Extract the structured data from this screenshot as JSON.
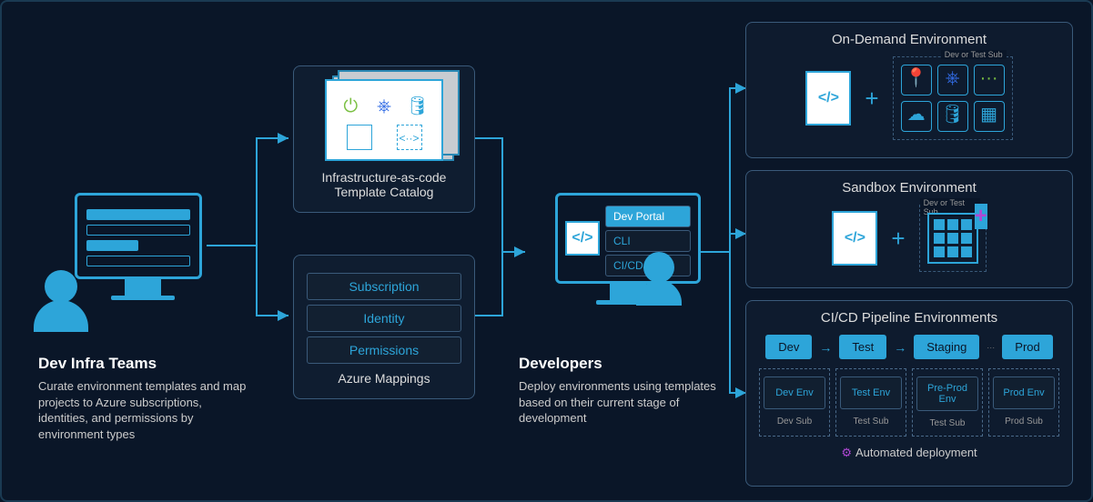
{
  "left": {
    "title": "Dev Infra Teams",
    "desc": "Curate environment templates and map projects to Azure subscriptions, identities, and permissions by environment types"
  },
  "template_catalog": {
    "label": "Infrastructure-as-code Template Catalog"
  },
  "azure_mappings": {
    "label": "Azure Mappings",
    "items": [
      "Subscription",
      "Identity",
      "Permissions"
    ]
  },
  "developers": {
    "title": "Developers",
    "desc": "Deploy environments using templates based on their current stage of development",
    "screen_items": [
      "Dev Portal",
      "CLI",
      "CI/CD"
    ]
  },
  "environments": {
    "ondemand": {
      "title": "On-Demand Environment",
      "sub_label": "Dev or Test Sub"
    },
    "sandbox": {
      "title": "Sandbox Environment",
      "sub_label": "Dev or Test Sub"
    },
    "cicd": {
      "title": "CI/CD Pipeline Environments",
      "stages": [
        "Dev",
        "Test",
        "Staging",
        "Prod"
      ],
      "envs": [
        {
          "name": "Dev Env",
          "sub": "Dev Sub"
        },
        {
          "name": "Test Env",
          "sub": "Test Sub"
        },
        {
          "name": "Pre-Prod Env",
          "sub": "Test Sub"
        },
        {
          "name": "Prod Env",
          "sub": "Prod Sub"
        }
      ],
      "automated": "Automated deployment"
    }
  }
}
